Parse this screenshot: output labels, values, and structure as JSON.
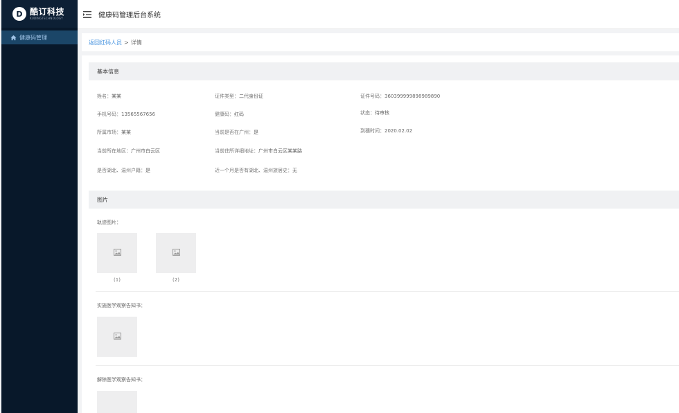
{
  "brand": {
    "mark": "D",
    "name": "酷订科技",
    "sub": "KUDINGTECHNOLOGY"
  },
  "sidebar": {
    "items": [
      {
        "label": "健康码管理",
        "icon": "home-icon"
      }
    ]
  },
  "header": {
    "title": "健康码管理后台系统"
  },
  "breadcrumb": {
    "back": "返回红码人员",
    "sep": ">",
    "current": "详情"
  },
  "basic": {
    "title": "基本信息",
    "fields": [
      {
        "label": "姓名：",
        "value": "某某"
      },
      {
        "label": "证件类型：",
        "value": "二代身份证"
      },
      {
        "label": "证件号码：",
        "value": "360399999898989890"
      },
      {
        "label": "手机号码：",
        "value": "13565567656"
      },
      {
        "label": "健康码：",
        "value": "红码"
      },
      {
        "label": "状态：",
        "value": "待审核"
      },
      {
        "label": "所属市场：",
        "value": "某某"
      },
      {
        "label": "当前是否在广州：",
        "value": "是"
      },
      {
        "label": "到穗时间：",
        "value": "2020.02.02"
      },
      {
        "label": "当前所在地区：",
        "value": "广州市白云区"
      },
      {
        "label": "当前住所详细地址：",
        "value": "广州市白云区某某路"
      },
      {
        "label": "是否湖北、温州户籍：",
        "value": "是"
      },
      {
        "label": "近一个月是否有湖北、温州旅居史：",
        "value": "无"
      }
    ]
  },
  "images": {
    "title": "图片",
    "track_label": "轨迹图片：",
    "captions": [
      "(1)",
      "(2)"
    ],
    "notice_label": "实施医学观察告知书：",
    "release_label": "解除医学观察告知书："
  },
  "colors": {
    "sidebar_bg": "#08182a",
    "active_item": "#1b4668",
    "link": "#3c8dde"
  }
}
